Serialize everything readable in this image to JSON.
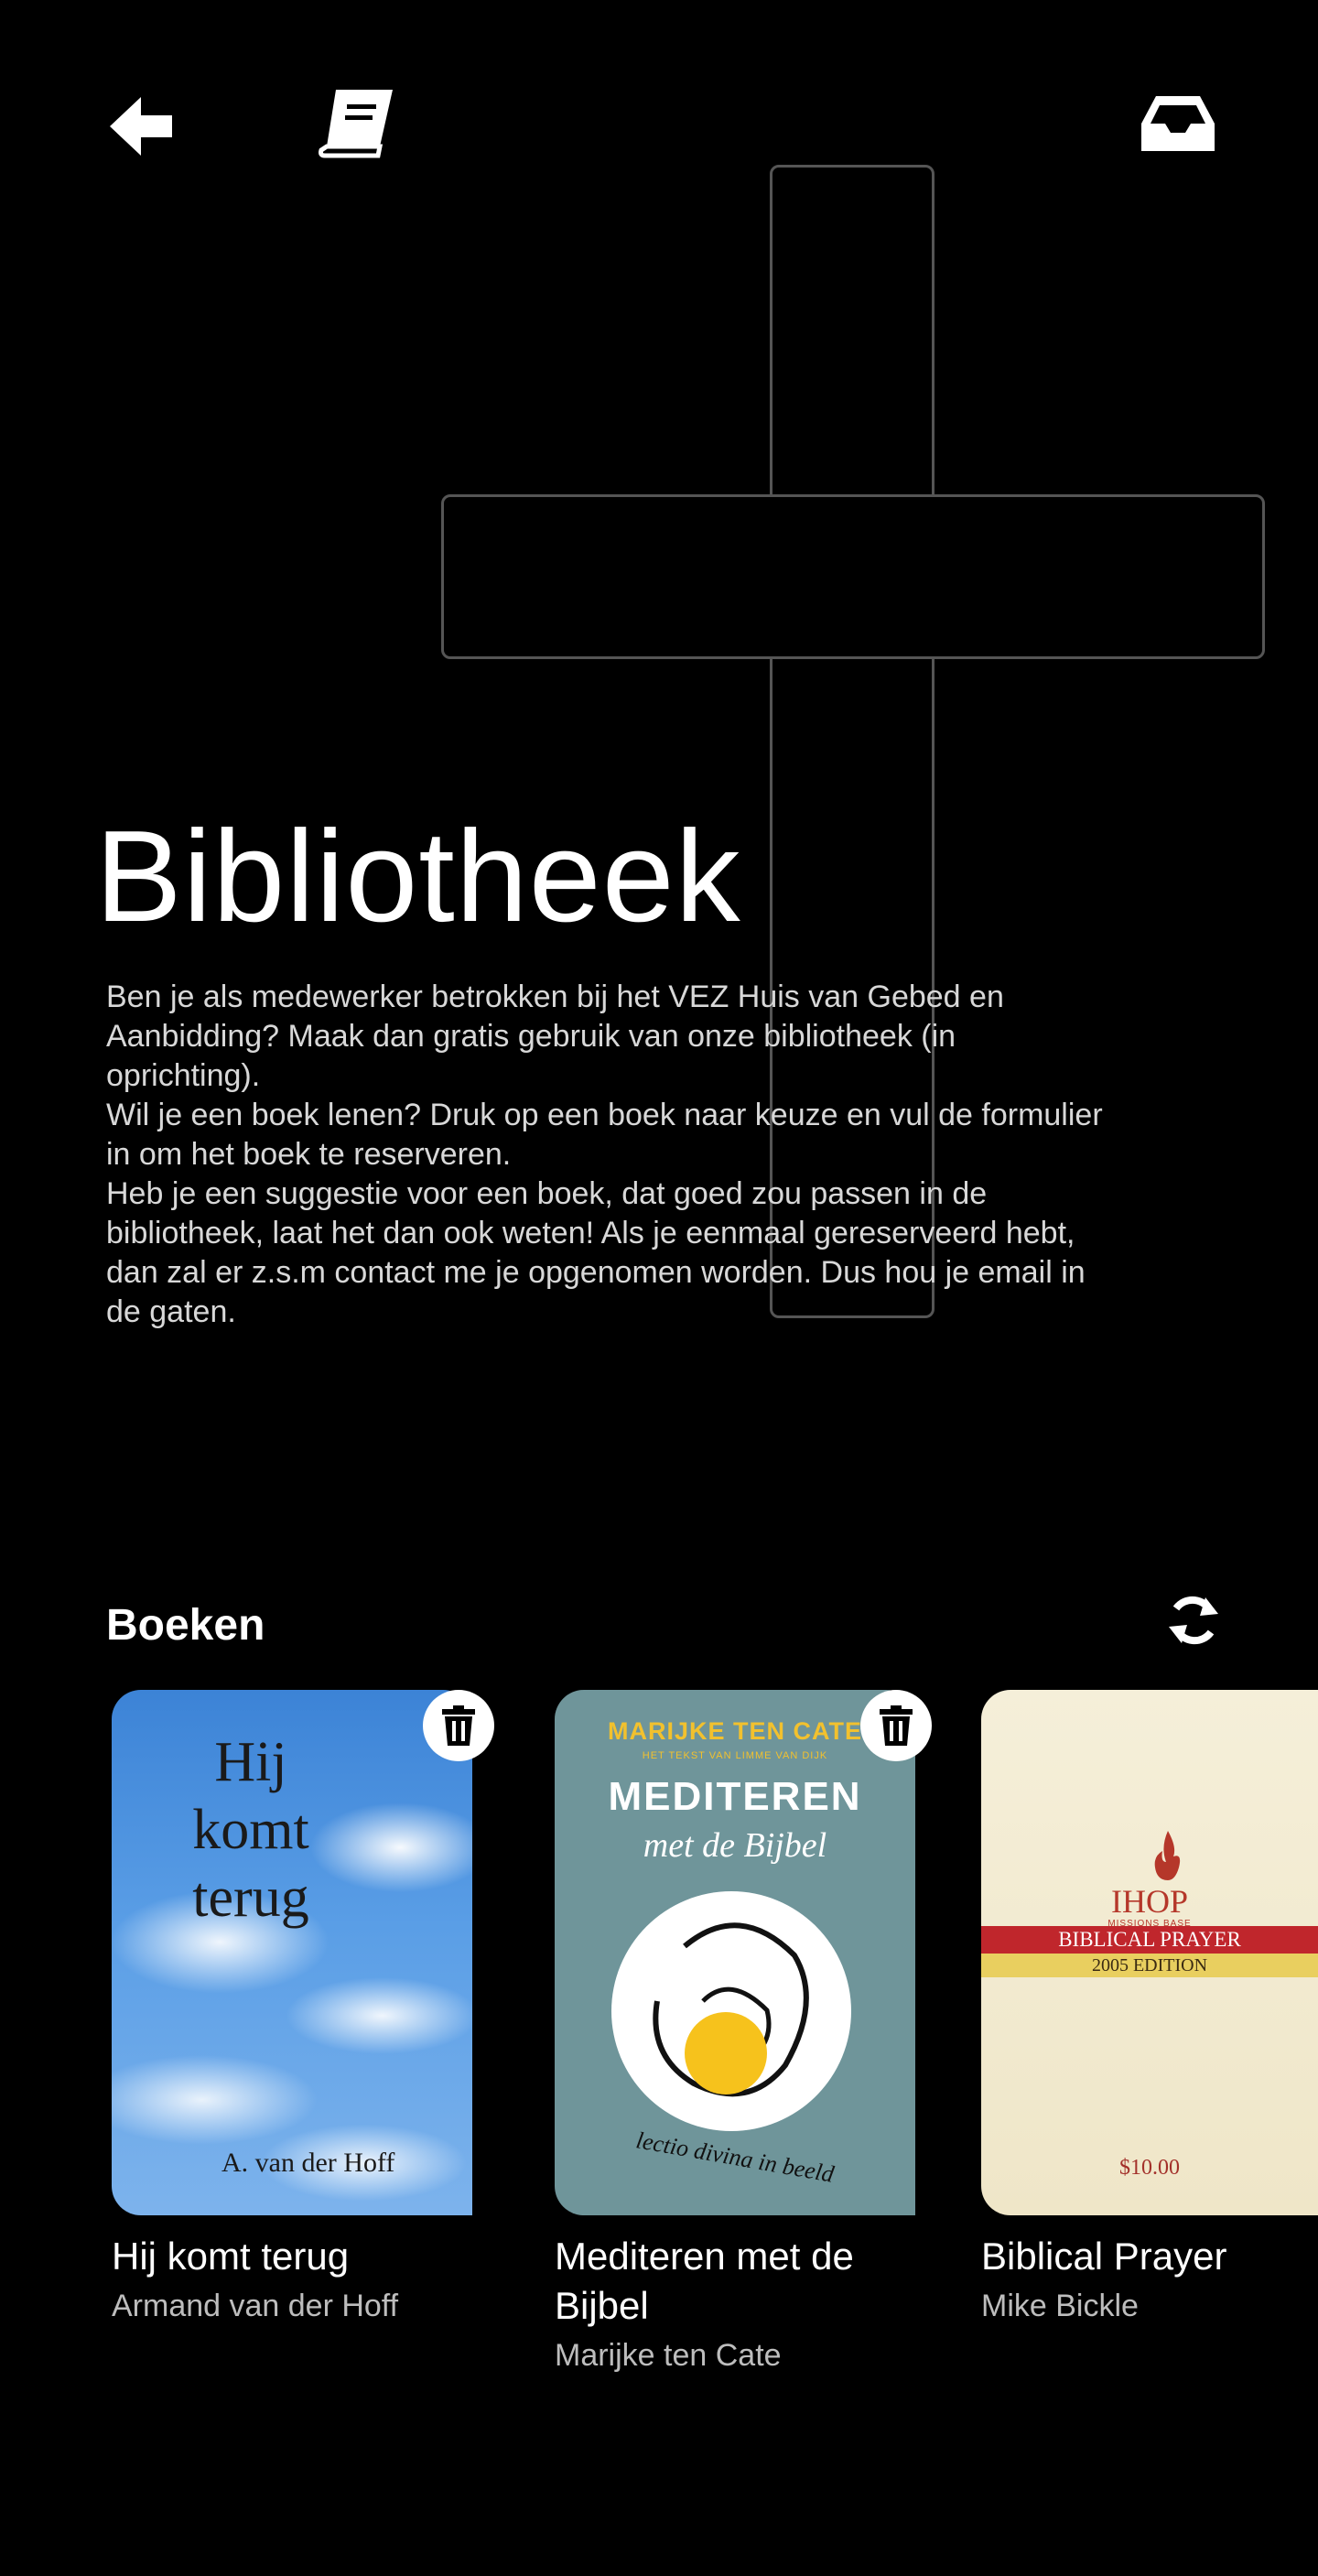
{
  "header": {
    "back_icon": "arrow-left-icon",
    "book_icon": "book-icon",
    "inbox_icon": "inbox-icon"
  },
  "hero": {
    "title": "Bibliotheek",
    "paragraphs": [
      "Ben je als medewerker betrokken bij het VEZ Huis van Gebed en Aanbidding? Maak dan gratis gebruik van onze bibliotheek (in oprichting).",
      "Wil je een boek lenen? Druk op een boek naar keuze en vul de formulier in om het boek te reserveren.",
      "Heb je een suggestie voor een boek, dat goed zou passen in de bibliotheek, laat het dan ook weten! Als je eenmaal gereserveerd hebt, dan zal er z.s.m contact me je opgenomen worden. Dus hou je email in de gaten."
    ]
  },
  "books_section": {
    "title": "Boeken",
    "refresh_icon": "refresh-icon",
    "items": [
      {
        "title": "Hij komt terug",
        "author": "Armand van der Hoff",
        "cover": {
          "title": "Hij komt terug",
          "author": "A. van der Hoff"
        }
      },
      {
        "title": "Mediteren met de Bijbel",
        "author": "Marijke ten Cate",
        "cover": {
          "author": "MARIJKE TEN CATE",
          "subtitle": "HET TEKST VAN LIMME VAN DIJK",
          "title": "MEDITEREN",
          "title2": "met de Bijbel",
          "footer": "lectio divina in beeld"
        }
      },
      {
        "title": "Biblical Prayer",
        "author": "Mike Bickle",
        "cover": {
          "brand": "IHOP",
          "brand_sub": "MISSIONS BASE",
          "title": "BIBLICAL PRAYER",
          "edition": "2005 EDITION",
          "price": "$10.00"
        }
      }
    ]
  },
  "colors": {
    "background": "#000000",
    "text": "#ffffff",
    "muted": "#bdbdbd"
  }
}
